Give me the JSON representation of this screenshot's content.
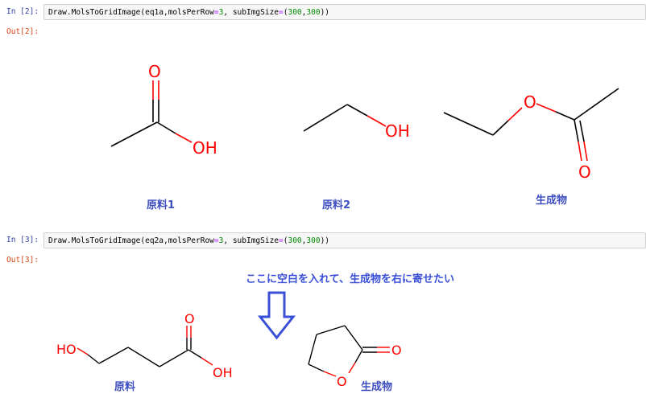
{
  "cell1": {
    "in_prompt": "In [2]:",
    "out_prompt": "Out[2]:",
    "code": {
      "part1": "Draw.MolsToGridImage(eq1a,molsPerRow",
      "eq1": "=",
      "n1": "3",
      "part2": ", subImgSize",
      "eq2": "=",
      "part3": "(",
      "n2": "300",
      "part4": ",",
      "n3": "300",
      "part5": "))"
    },
    "atoms": {
      "o1": "O",
      "oh1": "OH",
      "oh2": "OH",
      "o_ester": "O",
      "o_carbonyl": "O"
    },
    "captions": {
      "mol1": "原料1",
      "mol2": "原料2",
      "mol3": "生成物"
    }
  },
  "cell2": {
    "in_prompt": "In [3]:",
    "out_prompt": "Out[3]:",
    "code": {
      "part1": "Draw.MolsToGridImage(eq2a,molsPerRow",
      "eq1": "=",
      "n1": "3",
      "part2": ", subImgSize",
      "eq2": "=",
      "part3": "(",
      "n2": "300",
      "part4": ",",
      "n3": "300",
      "part5": "))"
    },
    "atoms": {
      "ho": "HO",
      "o_acid": "O",
      "oh_acid": "OH",
      "o_ring": "O",
      "o_lactone": "O"
    },
    "captions": {
      "mol1": "原料",
      "mol2": "生成物"
    },
    "note": "ここに空白を入れて、生成物を右に寄せたい"
  },
  "colors": {
    "bond": "#000000",
    "heteroatom": "#ff0000",
    "annotation": "#3a4fd8",
    "in_prompt": "#303f9f",
    "out_prompt": "#d84315"
  }
}
